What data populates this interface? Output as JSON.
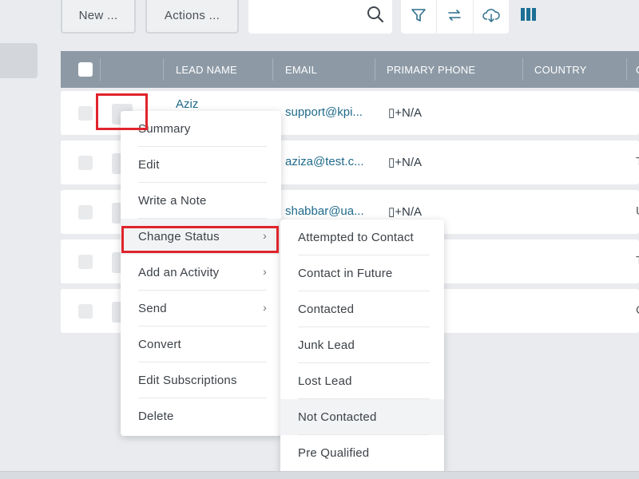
{
  "toolbar": {
    "new_label": "New ...",
    "actions_label": "Actions ...",
    "search_icon": "search-icon",
    "icons": [
      "filter-icon",
      "sync-icon",
      "cloud-download-icon",
      "columns-icon"
    ]
  },
  "table": {
    "headers": [
      "LEAD NAME",
      "EMAIL",
      "PRIMARY PHONE",
      "COUNTRY",
      "C"
    ],
    "rows": [
      {
        "name": "Aziz",
        "email": "support@kpi...",
        "phone": "▯+N/A",
        "edge": ""
      },
      {
        "name": "",
        "email": "aziza@test.c...",
        "phone": "▯+N/A",
        "edge": "T"
      },
      {
        "name": "",
        "email": "shabbar@ua...",
        "phone": "▯+N/A",
        "edge": "U"
      },
      {
        "name": "",
        "email": "",
        "phone": "",
        "edge": "T"
      },
      {
        "name": "",
        "email": "",
        "phone": "",
        "edge": "C"
      }
    ]
  },
  "context_menu": {
    "items": [
      {
        "label": "Summary"
      },
      {
        "label": "Edit"
      },
      {
        "label": "Write a Note"
      },
      {
        "label": "Change Status",
        "submenu": true
      },
      {
        "label": "Add an Activity",
        "submenu": true
      },
      {
        "label": "Send",
        "submenu": true
      },
      {
        "label": "Convert"
      },
      {
        "label": "Edit Subscriptions"
      },
      {
        "label": "Delete"
      }
    ],
    "chevron": "›"
  },
  "status_submenu": {
    "items": [
      {
        "label": "Attempted to Contact"
      },
      {
        "label": "Contact in Future"
      },
      {
        "label": "Contacted"
      },
      {
        "label": "Junk Lead"
      },
      {
        "label": "Lost Lead"
      },
      {
        "label": "Not Contacted"
      },
      {
        "label": "Pre Qualified"
      }
    ]
  },
  "colors": {
    "header": "#8d9aa6",
    "highlight": "#e0242c",
    "link": "#1f6a8a",
    "accent": "#1c6f95"
  }
}
